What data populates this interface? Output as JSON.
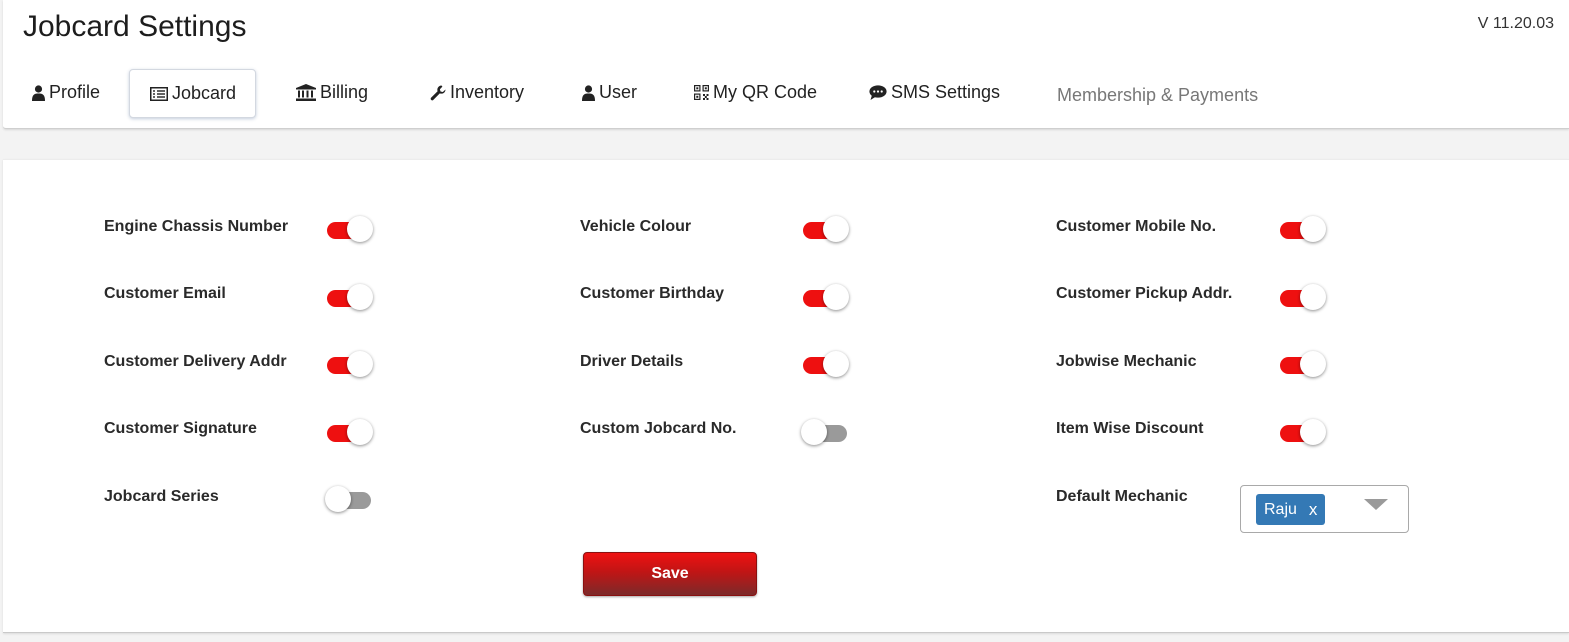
{
  "header": {
    "title": "Jobcard Settings",
    "version": "V 11.20.03"
  },
  "tabs": [
    {
      "label": "Profile",
      "icon": "user-icon"
    },
    {
      "label": "Jobcard",
      "icon": "list-icon",
      "active": true
    },
    {
      "label": "Billing",
      "icon": "bank-icon"
    },
    {
      "label": "Inventory",
      "icon": "wrench-icon"
    },
    {
      "label": "User",
      "icon": "user-icon"
    },
    {
      "label": "My QR Code",
      "icon": "qrcode-icon"
    },
    {
      "label": "SMS Settings",
      "icon": "comment-icon"
    },
    {
      "label": "Membership & Payments",
      "icon": ""
    }
  ],
  "settings": {
    "engine_chassis_number": {
      "label": "Engine Chassis Number",
      "enabled": true
    },
    "vehicle_colour": {
      "label": "Vehicle Colour",
      "enabled": true
    },
    "customer_mobile_no": {
      "label": "Customer Mobile No.",
      "enabled": true
    },
    "customer_email": {
      "label": "Customer Email",
      "enabled": true
    },
    "customer_birthday": {
      "label": "Customer Birthday",
      "enabled": true
    },
    "customer_pickup_addr": {
      "label": "Customer Pickup Addr.",
      "enabled": true
    },
    "customer_delivery_addr": {
      "label": "Customer Delivery Addr",
      "enabled": true
    },
    "driver_details": {
      "label": "Driver Details",
      "enabled": true
    },
    "jobwise_mechanic": {
      "label": "Jobwise Mechanic",
      "enabled": true
    },
    "customer_signature": {
      "label": "Customer Signature",
      "enabled": true
    },
    "custom_jobcard_no": {
      "label": "Custom Jobcard No.",
      "enabled": false
    },
    "item_wise_discount": {
      "label": "Item Wise Discount",
      "enabled": true
    },
    "jobcard_series": {
      "label": "Jobcard Series",
      "enabled": false
    }
  },
  "default_mechanic": {
    "label": "Default Mechanic",
    "selected": "Raju",
    "remove_symbol": "x"
  },
  "save_label": "Save",
  "colors": {
    "toggle_on": "#ee1010",
    "toggle_off": "#9a9a9a",
    "chip": "#3479b5",
    "save_button": "#d01414"
  }
}
